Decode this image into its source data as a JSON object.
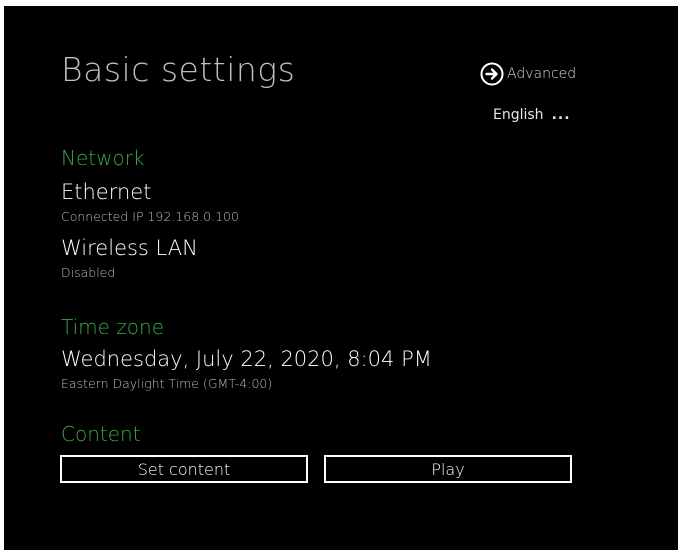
{
  "header": {
    "title": "Basic settings",
    "advanced_label": "Advanced",
    "advanced_icon": "arrow-right-circle-icon",
    "language_label": "English",
    "language_more": "..."
  },
  "network": {
    "section_label": "Network",
    "ethernet": {
      "title": "Ethernet",
      "status": "Connected IP 192.168.0.100"
    },
    "wireless": {
      "title": "Wireless LAN",
      "status": "Disabled"
    }
  },
  "time_zone": {
    "section_label": "Time zone",
    "datetime": "Wednesday, July 22, 2020, 8:04 PM",
    "zone": "Eastern Daylight Time (GMT-4:00)"
  },
  "content": {
    "section_label": "Content",
    "set_content_label": "Set content",
    "play_label": "Play"
  },
  "colors": {
    "background": "#000000",
    "section_accent": "#3aa846",
    "text": "#ffffff"
  }
}
